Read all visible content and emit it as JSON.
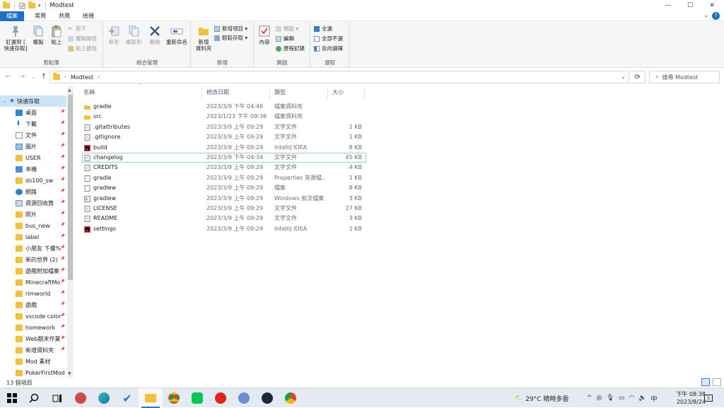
{
  "window": {
    "title": "Modtest",
    "controls": {
      "minimize": "—",
      "maximize": "☐",
      "close": "✕"
    }
  },
  "tabs": [
    {
      "label": "檔案"
    },
    {
      "label": "常用"
    },
    {
      "label": "共用"
    },
    {
      "label": "檢視"
    }
  ],
  "ribbon": {
    "clipboard": {
      "label": "剪貼簿",
      "pin": "釘選到 [\n快速存取]",
      "copy": "複製",
      "paste": "貼上",
      "cut": "剪下",
      "copy_path": "複製路徑",
      "paste_shortcut": "貼上捷徑"
    },
    "organize": {
      "label": "組合管理",
      "move_to": "移至",
      "copy_to": "複製到",
      "delete": "刪除",
      "rename": "重新命名"
    },
    "new": {
      "label": "新增",
      "new_folder": "新增\n資料夾",
      "new_item": "新增項目 ▾",
      "easy_access": "輕鬆存取 ▾"
    },
    "open": {
      "label": "開啟",
      "properties": "內容",
      "open": "開啟 ▾",
      "edit": "編輯",
      "history": "歷程記錄"
    },
    "select": {
      "label": "選取",
      "select_all": "全選",
      "select_none": "全部不選",
      "invert": "反向選擇"
    }
  },
  "address": {
    "crumb": "Modtest",
    "search_placeholder": "搜尋 Modtest"
  },
  "navpane": {
    "header": "快速存取",
    "items": [
      {
        "label": "桌面",
        "icon": "desktop-icon"
      },
      {
        "label": "下載",
        "icon": "download-icon"
      },
      {
        "label": "文件",
        "icon": "documents-icon"
      },
      {
        "label": "圖片",
        "icon": "pictures-icon"
      },
      {
        "label": "USER",
        "icon": "folder-icon"
      },
      {
        "label": "本機",
        "icon": "pc-icon"
      },
      {
        "label": "ds100_sw",
        "icon": "folder-icon"
      },
      {
        "label": "網路",
        "icon": "network-icon"
      },
      {
        "label": "資源回收筒",
        "icon": "recycle-bin-icon"
      },
      {
        "label": "照片",
        "icon": "folder-icon"
      },
      {
        "label": "bus_new",
        "icon": "folder-icon"
      },
      {
        "label": "label",
        "icon": "folder-icon"
      },
      {
        "label": "小朋友 下樓%",
        "icon": "folder-icon"
      },
      {
        "label": "新的世界 (2)",
        "icon": "folder-icon"
      },
      {
        "label": "遊戲附加檔案",
        "icon": "folder-icon"
      },
      {
        "label": "MinecraftMo",
        "icon": "folder-icon"
      },
      {
        "label": "rimworld",
        "icon": "folder-icon"
      },
      {
        "label": "遊戲",
        "icon": "folder-icon"
      },
      {
        "label": "vscode color",
        "icon": "folder-icon"
      },
      {
        "label": "homework",
        "icon": "folder-icon"
      },
      {
        "label": "Web期末作業",
        "icon": "folder-icon"
      },
      {
        "label": "新增資料夾",
        "icon": "folder-icon"
      },
      {
        "label": "Mod 素材",
        "icon": "folder-icon"
      },
      {
        "label": "PokerFirstMod",
        "icon": "folder-icon"
      }
    ]
  },
  "columns": {
    "name": "名稱",
    "date": "修改日期",
    "type": "類型",
    "size": "大小"
  },
  "files": [
    {
      "name": "gradle",
      "date": "2023/3/9 下午 04:46",
      "type": "檔案資料夾",
      "size": "",
      "icon": "folder-icon"
    },
    {
      "name": "src",
      "date": "2023/1/23 下午 09:36",
      "type": "檔案資料夾",
      "size": "",
      "icon": "folder-icon"
    },
    {
      "name": ".gitattributes",
      "date": "2023/3/9 上午 09:29",
      "type": "文字文件",
      "size": "1 KB",
      "icon": "text-file-icon"
    },
    {
      "name": ".gitignore",
      "date": "2023/3/9 上午 09:29",
      "type": "文字文件",
      "size": "1 KB",
      "icon": "text-file-icon"
    },
    {
      "name": "build",
      "date": "2023/3/9 上午 09:29",
      "type": "IntelliJ IDEA",
      "size": "8 KB",
      "icon": "intellij-icon"
    },
    {
      "name": "changelog",
      "date": "2023/3/9 下午 04:34",
      "type": "文字文件",
      "size": "45 KB",
      "icon": "text-file-icon"
    },
    {
      "name": "CREDITS",
      "date": "2023/3/9 上午 09:29",
      "type": "文字文件",
      "size": "4 KB",
      "icon": "text-file-icon"
    },
    {
      "name": "gradle",
      "date": "2023/3/9 上午 09:29",
      "type": "Properties 來源檔...",
      "size": "1 KB",
      "icon": "file-icon"
    },
    {
      "name": "gradlew",
      "date": "2023/3/9 上午 09:29",
      "type": "檔案",
      "size": "8 KB",
      "icon": "file-icon"
    },
    {
      "name": "gradlew",
      "date": "2023/3/9 上午 09:29",
      "type": "Windows 批次檔案",
      "size": "3 KB",
      "icon": "batch-file-icon"
    },
    {
      "name": "LICENSE",
      "date": "2023/3/9 上午 09:29",
      "type": "文字文件",
      "size": "27 KB",
      "icon": "text-file-icon"
    },
    {
      "name": "README",
      "date": "2023/3/9 上午 09:29",
      "type": "文字文件",
      "size": "3 KB",
      "icon": "text-file-icon"
    },
    {
      "name": "settings",
      "date": "2023/3/9 上午 09:29",
      "type": "IntelliJ IDEA",
      "size": "1 KB",
      "icon": "intellij-icon"
    }
  ],
  "status": {
    "count": "13 個項目"
  },
  "taskbar": {
    "weather": "29°C  晴時多雲",
    "ime": "中",
    "time": "下午 08:38",
    "date": "2023/8/24",
    "notification_count": "5"
  },
  "colors": {
    "accent": "#1a6fc9",
    "folder": "#f3c03a",
    "selection": "#cce4f7"
  }
}
